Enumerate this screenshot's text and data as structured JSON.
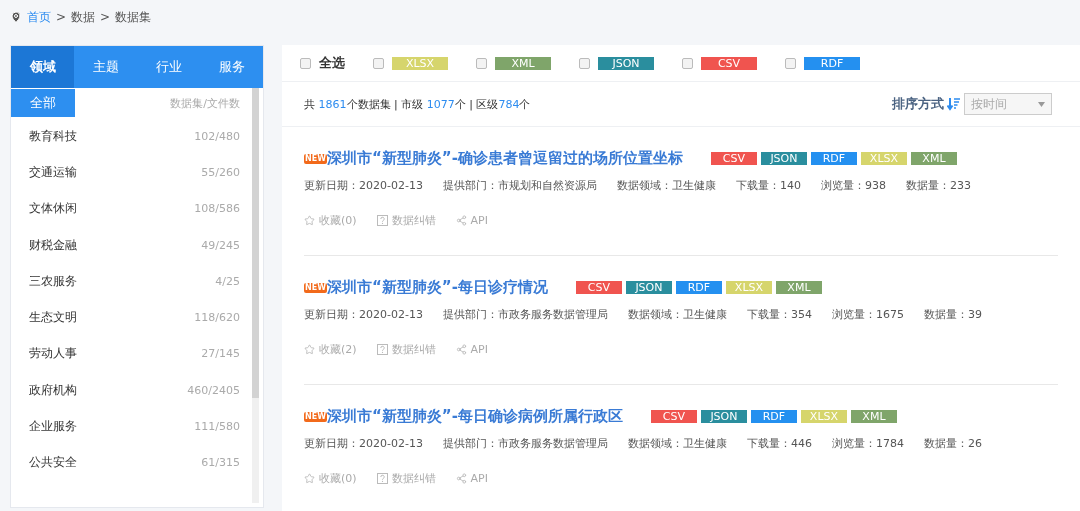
{
  "breadcrumb": {
    "separator": ">",
    "items": [
      {
        "label": "首页",
        "link": true
      },
      {
        "label": "数据",
        "link": false
      },
      {
        "label": "数据集",
        "link": false
      }
    ]
  },
  "sidebar": {
    "tabs": [
      {
        "label": "领域",
        "selected": true
      },
      {
        "label": "主题",
        "selected": false
      },
      {
        "label": "行业",
        "selected": false
      },
      {
        "label": "服务",
        "selected": false
      }
    ],
    "all": {
      "label": "全部",
      "selected": true
    },
    "column_label": "数据集/文件数",
    "items": [
      {
        "name": "教育科技",
        "count": "102/480"
      },
      {
        "name": "交通运输",
        "count": "55/260"
      },
      {
        "name": "文体休闲",
        "count": "108/586"
      },
      {
        "name": "财税金融",
        "count": "49/245"
      },
      {
        "name": "三农服务",
        "count": "4/25"
      },
      {
        "name": "生态文明",
        "count": "118/620"
      },
      {
        "name": "劳动人事",
        "count": "27/145"
      },
      {
        "name": "政府机构",
        "count": "460/2405"
      },
      {
        "name": "企业服务",
        "count": "111/580"
      },
      {
        "name": "公共安全",
        "count": "61/315"
      }
    ]
  },
  "filters": {
    "select_all": {
      "label": "全选",
      "checked": false
    },
    "formats": [
      {
        "label": "XLSX",
        "color": "#d6d56c",
        "checked": false
      },
      {
        "label": "XML",
        "color": "#7fa56a",
        "checked": false
      },
      {
        "label": "JSON",
        "color": "#2a8e9e",
        "checked": false
      },
      {
        "label": "CSV",
        "color": "#f0544f",
        "checked": false
      },
      {
        "label": "RDF",
        "color": "#2490f0",
        "checked": false
      }
    ]
  },
  "stats": {
    "separator": "|",
    "parts": [
      {
        "prefix": "共 ",
        "value": "1861",
        "suffix": "个数据集"
      },
      {
        "prefix": "市级 ",
        "value": "1077",
        "suffix": "个"
      },
      {
        "prefix": "区级",
        "value": "784",
        "suffix": "个"
      }
    ]
  },
  "sort": {
    "label": "排序方式",
    "value": "按时间"
  },
  "datasets": [
    {
      "badge": "NEW",
      "title": "深圳市“新型肺炎”-确诊患者曾逗留过的场所位置坐标",
      "tags": [
        {
          "label": "CSV",
          "color": "#f0544f"
        },
        {
          "label": "JSON",
          "color": "#2a8e9e"
        },
        {
          "label": "RDF",
          "color": "#2490f0"
        },
        {
          "label": "XLSX",
          "color": "#d6d56c"
        },
        {
          "label": "XML",
          "color": "#7fa56a"
        }
      ],
      "meta": [
        "更新日期：2020-02-13",
        "提供部门：市规划和自然资源局",
        "数据领域：卫生健康",
        "下载量：140",
        "浏览量：938",
        "数据量：233"
      ],
      "favorite": "收藏(0)",
      "report": "数据纠错",
      "api": "API"
    },
    {
      "badge": "NEW",
      "title": "深圳市“新型肺炎”-每日诊疗情况",
      "tags": [
        {
          "label": "CSV",
          "color": "#f0544f"
        },
        {
          "label": "JSON",
          "color": "#2a8e9e"
        },
        {
          "label": "RDF",
          "color": "#2490f0"
        },
        {
          "label": "XLSX",
          "color": "#d6d56c"
        },
        {
          "label": "XML",
          "color": "#7fa56a"
        }
      ],
      "meta": [
        "更新日期：2020-02-13",
        "提供部门：市政务服务数据管理局",
        "数据领域：卫生健康",
        "下载量：354",
        "浏览量：1675",
        "数据量：39"
      ],
      "favorite": "收藏(2)",
      "report": "数据纠错",
      "api": "API"
    },
    {
      "badge": "NEW",
      "title": "深圳市“新型肺炎”-每日确诊病例所属行政区",
      "tags": [
        {
          "label": "CSV",
          "color": "#f0544f"
        },
        {
          "label": "JSON",
          "color": "#2a8e9e"
        },
        {
          "label": "RDF",
          "color": "#2490f0"
        },
        {
          "label": "XLSX",
          "color": "#d6d56c"
        },
        {
          "label": "XML",
          "color": "#7fa56a"
        }
      ],
      "meta": [
        "更新日期：2020-02-13",
        "提供部门：市政务服务数据管理局",
        "数据领域：卫生健康",
        "下载量：446",
        "浏览量：1784",
        "数据量：26"
      ],
      "favorite": "收藏(0)",
      "report": "数据纠错",
      "api": "API"
    }
  ]
}
